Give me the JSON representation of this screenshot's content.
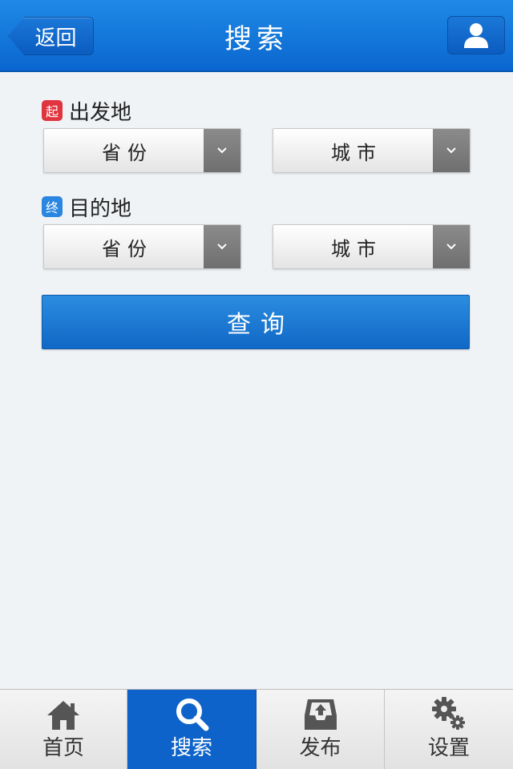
{
  "header": {
    "back_label": "返回",
    "title": "搜索"
  },
  "origin": {
    "badge": "起",
    "label": "出发地",
    "province_placeholder": "省份",
    "city_placeholder": "城市"
  },
  "destination": {
    "badge": "终",
    "label": "目的地",
    "province_placeholder": "省份",
    "city_placeholder": "城市"
  },
  "query_button": "查询",
  "tabbar": {
    "items": [
      {
        "label": "首页",
        "icon": "home-icon",
        "active": false
      },
      {
        "label": "搜索",
        "icon": "search-icon",
        "active": true
      },
      {
        "label": "发布",
        "icon": "inbox-upload-icon",
        "active": false
      },
      {
        "label": "设置",
        "icon": "gear-icon",
        "active": false
      }
    ]
  },
  "colors": {
    "primary": "#0d63c9",
    "badge_origin": "#e0353f",
    "badge_destination": "#2a86e0",
    "background": "#f0f3f6"
  }
}
